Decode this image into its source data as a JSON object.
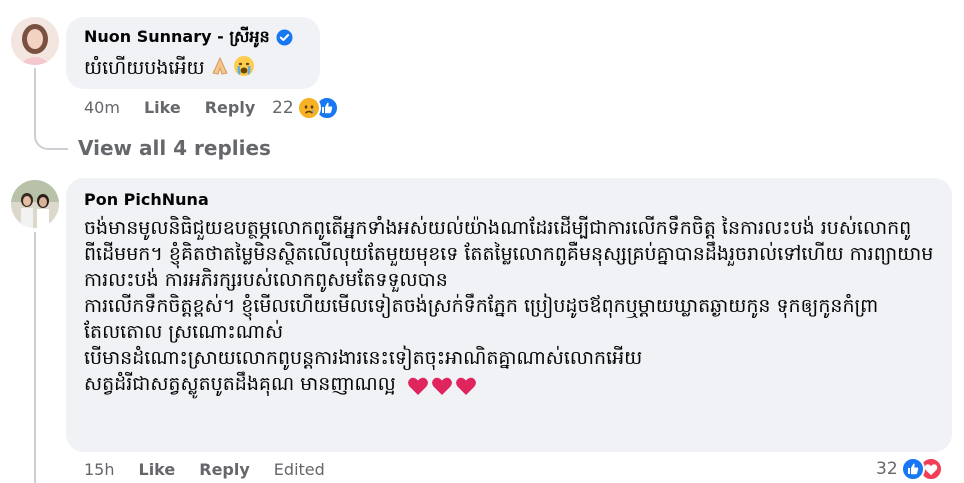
{
  "comments": [
    {
      "author": "Nuon Sunnary - ស្រីអូន",
      "verified": true,
      "text": "យំហើយបងអើយ",
      "time": "40m",
      "like_label": "Like",
      "reply_label": "Reply",
      "reaction_count": "22",
      "reactions": [
        "sad-icon",
        "like-icon"
      ]
    },
    {
      "author": "Pon PichNuna",
      "verified": false,
      "text": "ចង់មានមូលនិធិជួយឧបត្ថម្ភលោកពូតើអ្នកទាំងអស់យល់យ៉ាងណាដែរដើម្បីជាការលើកទឹកចិត្ត នៃការលះបង់ របស់លោកពូពីដើមមក។ ខ្ញុំគិតថាតម្លៃមិនស្ថិតលើលុយតែមួយមុខទេ តែតម្លៃលោកពូគឺមនុស្សគ្រប់គ្នាបានដឹងរួចរាល់ទៅហើយ ការព្យាយាម ការលះបង់ ការអភិរក្សរបស់លោកពូសមតែទទួលបាន\nការលើកទឹកចិត្តខ្ពស់។ ខ្ញុំមើលហើយមើលទៀតចង់ស្រក់ទឹកភ្នែក ប្រៀបដូចឪពុកឬម្តាយឃ្លាតឆ្ងាយកូន ទុកឲ្យកូនកំព្រាតែលតោល ស្រណោះណាស់\nបើមានដំណោះស្រាយលោកពូបន្តការងារនេះទៀតចុះអាណិតគ្នាណាស់លោកអើយ\nសត្វដំរីជាសត្វស្លូតបូតដឹងគុណ មានញាណល្អ",
      "time": "15h",
      "like_label": "Like",
      "reply_label": "Reply",
      "edited_label": "Edited",
      "reaction_count": "32",
      "reactions": [
        "like-icon",
        "love-icon"
      ]
    }
  ],
  "view_replies_label": "View all 4 replies",
  "colors": {
    "bubble": "#f0f2f5",
    "meta": "#65676b",
    "like_blue": "#1877f2",
    "love_red": "#f33e58",
    "heart": "#e0245e",
    "sad_yellow": "#f7b125",
    "thread": "#ccd0d5"
  }
}
